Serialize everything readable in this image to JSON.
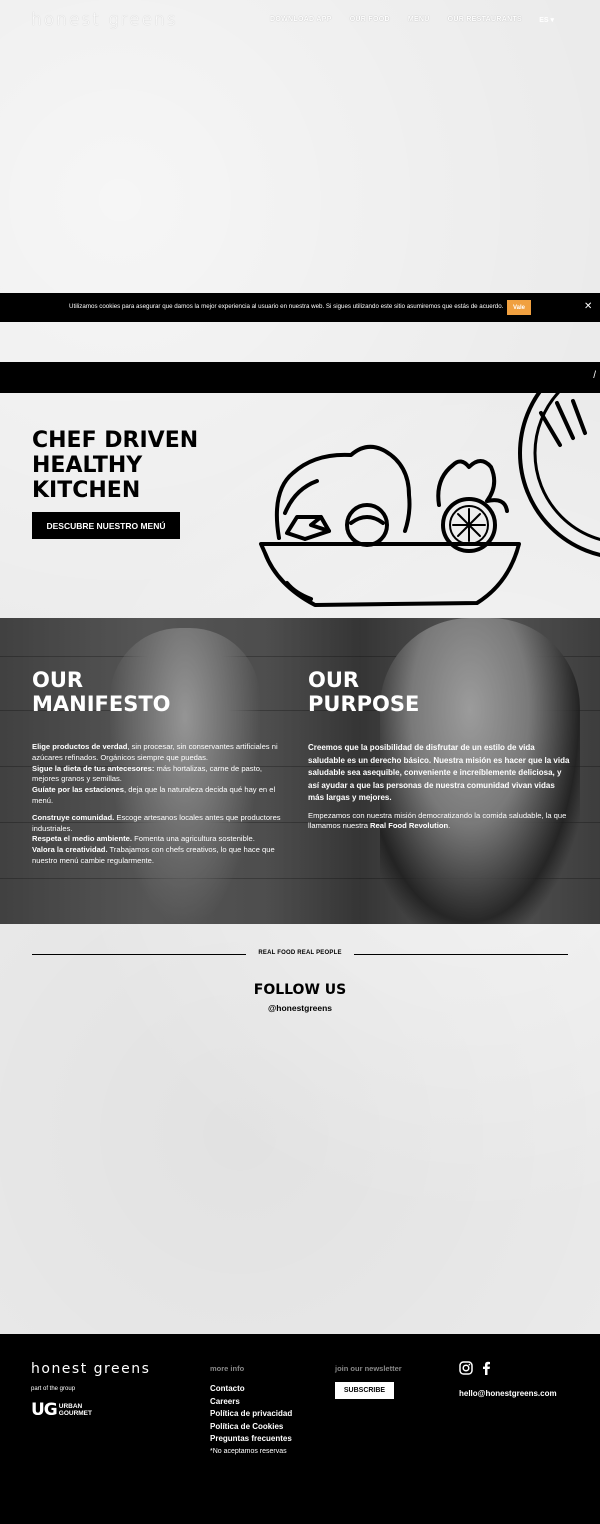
{
  "header": {
    "logo": "honest greens",
    "nav": [
      "DOWNLOAD APP",
      "OUR FOOD",
      "MENU",
      "OUR RESTAURANTS"
    ],
    "lang": "ES ▾"
  },
  "cookie": {
    "text": "Utilizamos cookies para asegurar que damos la mejor experiencia al usuario en nuestra web. Si sigues utilizando este sitio asumiremos que estás de acuerdo.",
    "button": "Vale",
    "close": "✕"
  },
  "hero": {
    "title": "CHEF DRIVEN\nHEALTHY\nKITCHEN",
    "button": "DESCUBRE NUESTRO MENÚ"
  },
  "manifesto": {
    "title": "OUR\nMANIFESTO",
    "p1": [
      {
        "b": "Elige productos de verdad",
        "t": ", sin procesar, sin conservantes artificiales ni azúcares refinados. Orgánicos siempre que puedas."
      },
      {
        "b": "Sigue la dieta de tus antecesores:",
        "t": " más hortalizas, carne de pasto, mejores granos y semillas."
      },
      {
        "b": "Guíate por las estaciones",
        "t": ", deja que la naturaleza decida qué hay en el menú."
      }
    ],
    "p2": [
      {
        "b": "Construye comunidad.",
        "t": " Escoge artesanos locales antes que productores industriales."
      },
      {
        "b": "Respeta el medio ambiente.",
        "t": " Fomenta una agricultura sostenible."
      },
      {
        "b": "Valora la creatividad.",
        "t": " Trabajamos con chefs creativos, lo que hace que nuestro menú cambie regularmente."
      }
    ]
  },
  "purpose": {
    "title": "OUR\nPURPOSE",
    "bold": "Creemos que la posibilidad de disfrutar de un estilo de vida saludable es un derecho básico. Nuestra misión es hacer que la vida saludable sea asequible, conveniente e increíblemente deliciosa, y así ayudar a que las personas de nuestra comunidad vivan vidas más largas y mejores.",
    "text": "Empezamos con nuestra misión democratizando la comida saludable, la que llamamos nuestra ",
    "text_bold": "Real Food Revolution",
    "text_end": "."
  },
  "social": {
    "divider_label": "REAL FOOD REAL PEOPLE",
    "title": "FOLLOW US",
    "handle": "@honestgreens"
  },
  "footer": {
    "logo": "honest greens",
    "group_label": "part of the group",
    "ug_mark": "UG",
    "ug_words": "URBAN\nGOURMET",
    "more_info_head": "more info",
    "links": [
      "Contacto",
      "Careers",
      "Política de privacidad",
      "Política de Cookies",
      "Preguntas frecuentes"
    ],
    "note": "*No aceptamos reservas",
    "newsletter_head": "join our newsletter",
    "subscribe": "SUBSCRIBE",
    "email": "hello@honestgreens.com",
    "social_icons": [
      "instagram-icon",
      "facebook-icon"
    ]
  }
}
